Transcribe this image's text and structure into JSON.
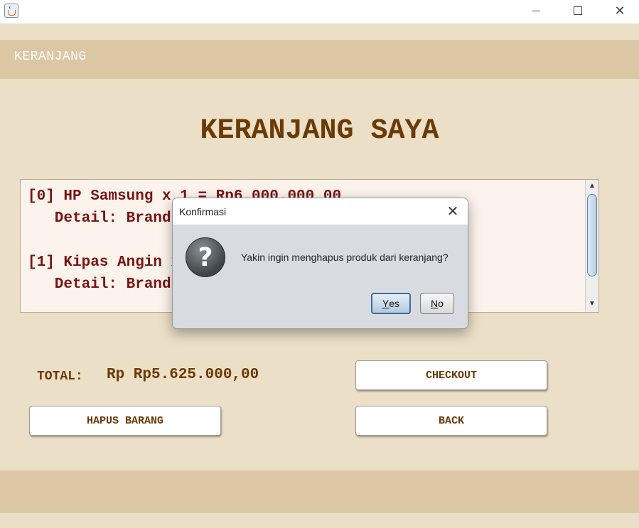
{
  "window": {
    "icon": "java-icon",
    "controls": [
      "minimize-icon",
      "maximize-icon",
      "close-icon"
    ]
  },
  "header": {
    "title": "KERANJANG"
  },
  "page": {
    "title": "KERANJANG SAYA"
  },
  "cart": {
    "lines": [
      "[0] HP Samsung x 1 = Rp6.000.000,00",
      "   Detail: Brand: Samsung",
      "",
      "[1] Kipas Angin x 1 = Rp250.000,00",
      "   Detail: Brand: Cosmos"
    ]
  },
  "total": {
    "label": "TOTAL:",
    "value": "Rp Rp5.625.000,00"
  },
  "buttons": {
    "checkout": "CHECKOUT",
    "remove": "HAPUS BARANG",
    "back": "BACK"
  },
  "dialog": {
    "title": "Konfirmasi",
    "icon": "question-icon",
    "message": "Yakin ingin menghapus produk dari keranjang?",
    "yes_mnemonic": "Y",
    "yes_rest": "es",
    "no_mnemonic": "N",
    "no_rest": "o"
  },
  "colors": {
    "background": "#ecdfc7",
    "bar": "#dcc7a5",
    "title_text": "#6b3a05",
    "list_text": "#7a1414"
  }
}
